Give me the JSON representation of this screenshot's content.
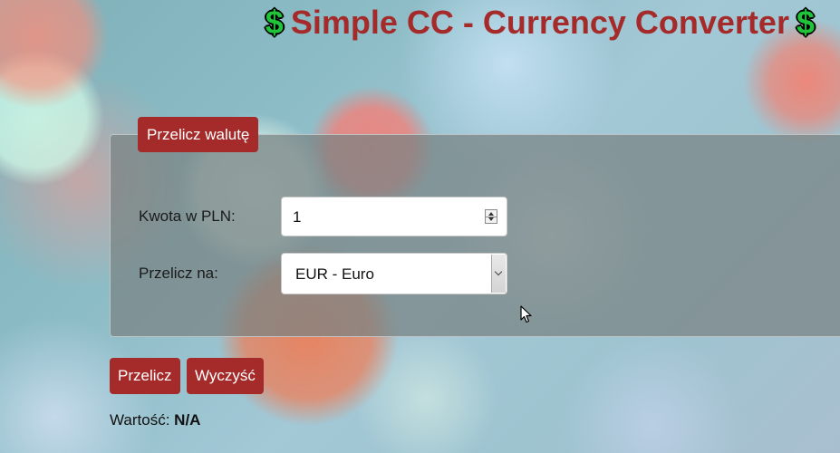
{
  "header": {
    "title": "Simple CC - Currency Converter",
    "left_icon": "dollar-icon",
    "right_icon": "dollar-icon",
    "dollar_glyph": "$",
    "icon_color": "#1fc43a",
    "title_color": "#a52a2a"
  },
  "form": {
    "legend": "Przelicz walutę",
    "amount_label": "Kwota w PLN:",
    "amount_value": "1",
    "target_label": "Przelicz na:",
    "target_value": "EUR - Euro"
  },
  "actions": {
    "convert_label": "Przelicz",
    "clear_label": "Wyczyść"
  },
  "result": {
    "label": "Wartość:",
    "value": "N/A"
  },
  "colors": {
    "accent": "#a52a2a"
  }
}
